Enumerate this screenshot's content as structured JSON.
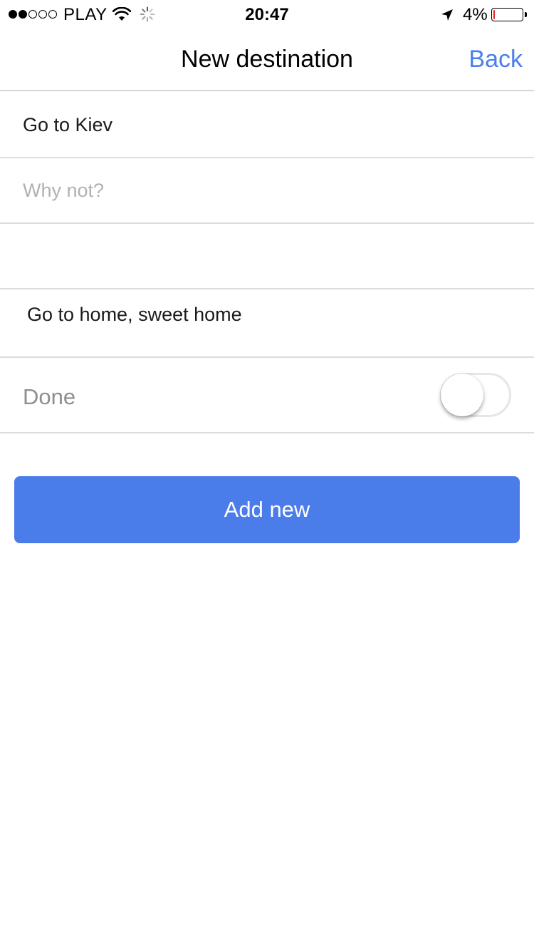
{
  "status_bar": {
    "signal_bars_filled": 2,
    "signal_bars_total": 5,
    "carrier": "PLAY",
    "time": "20:47",
    "battery_percent": "4%",
    "battery_level": 0.04,
    "icons": [
      "wifi-icon",
      "activity-spinner-icon",
      "location-arrow-icon",
      "battery-icon"
    ]
  },
  "nav": {
    "title": "New destination",
    "back_label": "Back"
  },
  "form": {
    "destination_value": "Go to Kiev",
    "destination_placeholder": "",
    "reason_value": "",
    "reason_placeholder": "Why not?",
    "extra_value": "",
    "note_text": "Go to home, sweet home",
    "done_label": "Done",
    "done_checked": false
  },
  "button": {
    "label": "Add new"
  },
  "colors": {
    "accent": "#4a7fea",
    "button_bg": "#4a7cea",
    "battery_low": "#e0261f",
    "separator": "#dcdcdc"
  }
}
